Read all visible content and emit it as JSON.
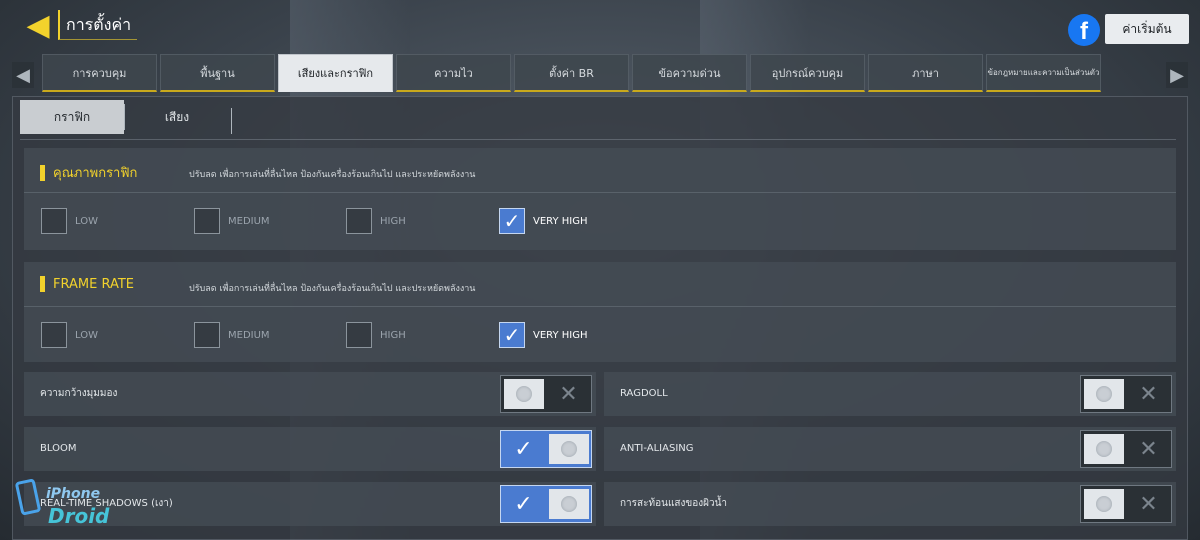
{
  "header": {
    "title": "การตั้งค่า",
    "reset_label": "ค่าเริ่มต้น"
  },
  "icons": {
    "back": "back-arrow-icon",
    "facebook": "facebook-icon",
    "tab_left": "chevron-left-icon",
    "tab_right": "chevron-right-icon"
  },
  "tabs": [
    {
      "label": "การควบคุม",
      "active": false
    },
    {
      "label": "พื้นฐาน",
      "active": false
    },
    {
      "label": "เสียงและกราฟิก",
      "active": true
    },
    {
      "label": "ความไว",
      "active": false
    },
    {
      "label": "ตั้งค่า BR",
      "active": false
    },
    {
      "label": "ข้อความด่วน",
      "active": false
    },
    {
      "label": "อุปกรณ์ควบคุม",
      "active": false
    },
    {
      "label": "ภาษา",
      "active": false
    },
    {
      "label": "ข้อกฎหมายและความเป็นส่วนตัว",
      "active": false
    }
  ],
  "subtabs": [
    {
      "label": "กราฟิก",
      "active": true
    },
    {
      "label": "เสียง",
      "active": false
    }
  ],
  "graphics_quality": {
    "title": "คุณภาพกราฟิก",
    "description": "ปรับลด เพื่อการเล่นที่ลื่นไหล ป้องกันเครื่องร้อนเกินไป และประหยัดพลังงาน",
    "options": [
      "LOW",
      "MEDIUM",
      "HIGH",
      "VERY HIGH"
    ],
    "selected": "VERY HIGH"
  },
  "frame_rate": {
    "title": "FRAME RATE",
    "description": "ปรับลด เพื่อการเล่นที่ลื่นไหล ป้องกันเครื่องร้อนเกินไป และประหยัดพลังงาน",
    "options": [
      "LOW",
      "MEDIUM",
      "HIGH",
      "VERY HIGH"
    ],
    "selected": "VERY HIGH"
  },
  "toggles": [
    {
      "label": "ความกว้างมุมมอง",
      "on": false
    },
    {
      "label": "RAGDOLL",
      "on": false
    },
    {
      "label": "BLOOM",
      "on": true
    },
    {
      "label": "ANTI-ALIASING",
      "on": false
    },
    {
      "label": "REAL-TIME SHADOWS (เงา)",
      "on": true
    },
    {
      "label": "การสะท้อนแสงของผิวน้ำ",
      "on": false
    }
  ],
  "colors": {
    "accent": "#f2d22c",
    "toggle_on": "#4a7bd0"
  },
  "watermark": {
    "line1": "iPhone",
    "line2": "Droid"
  }
}
